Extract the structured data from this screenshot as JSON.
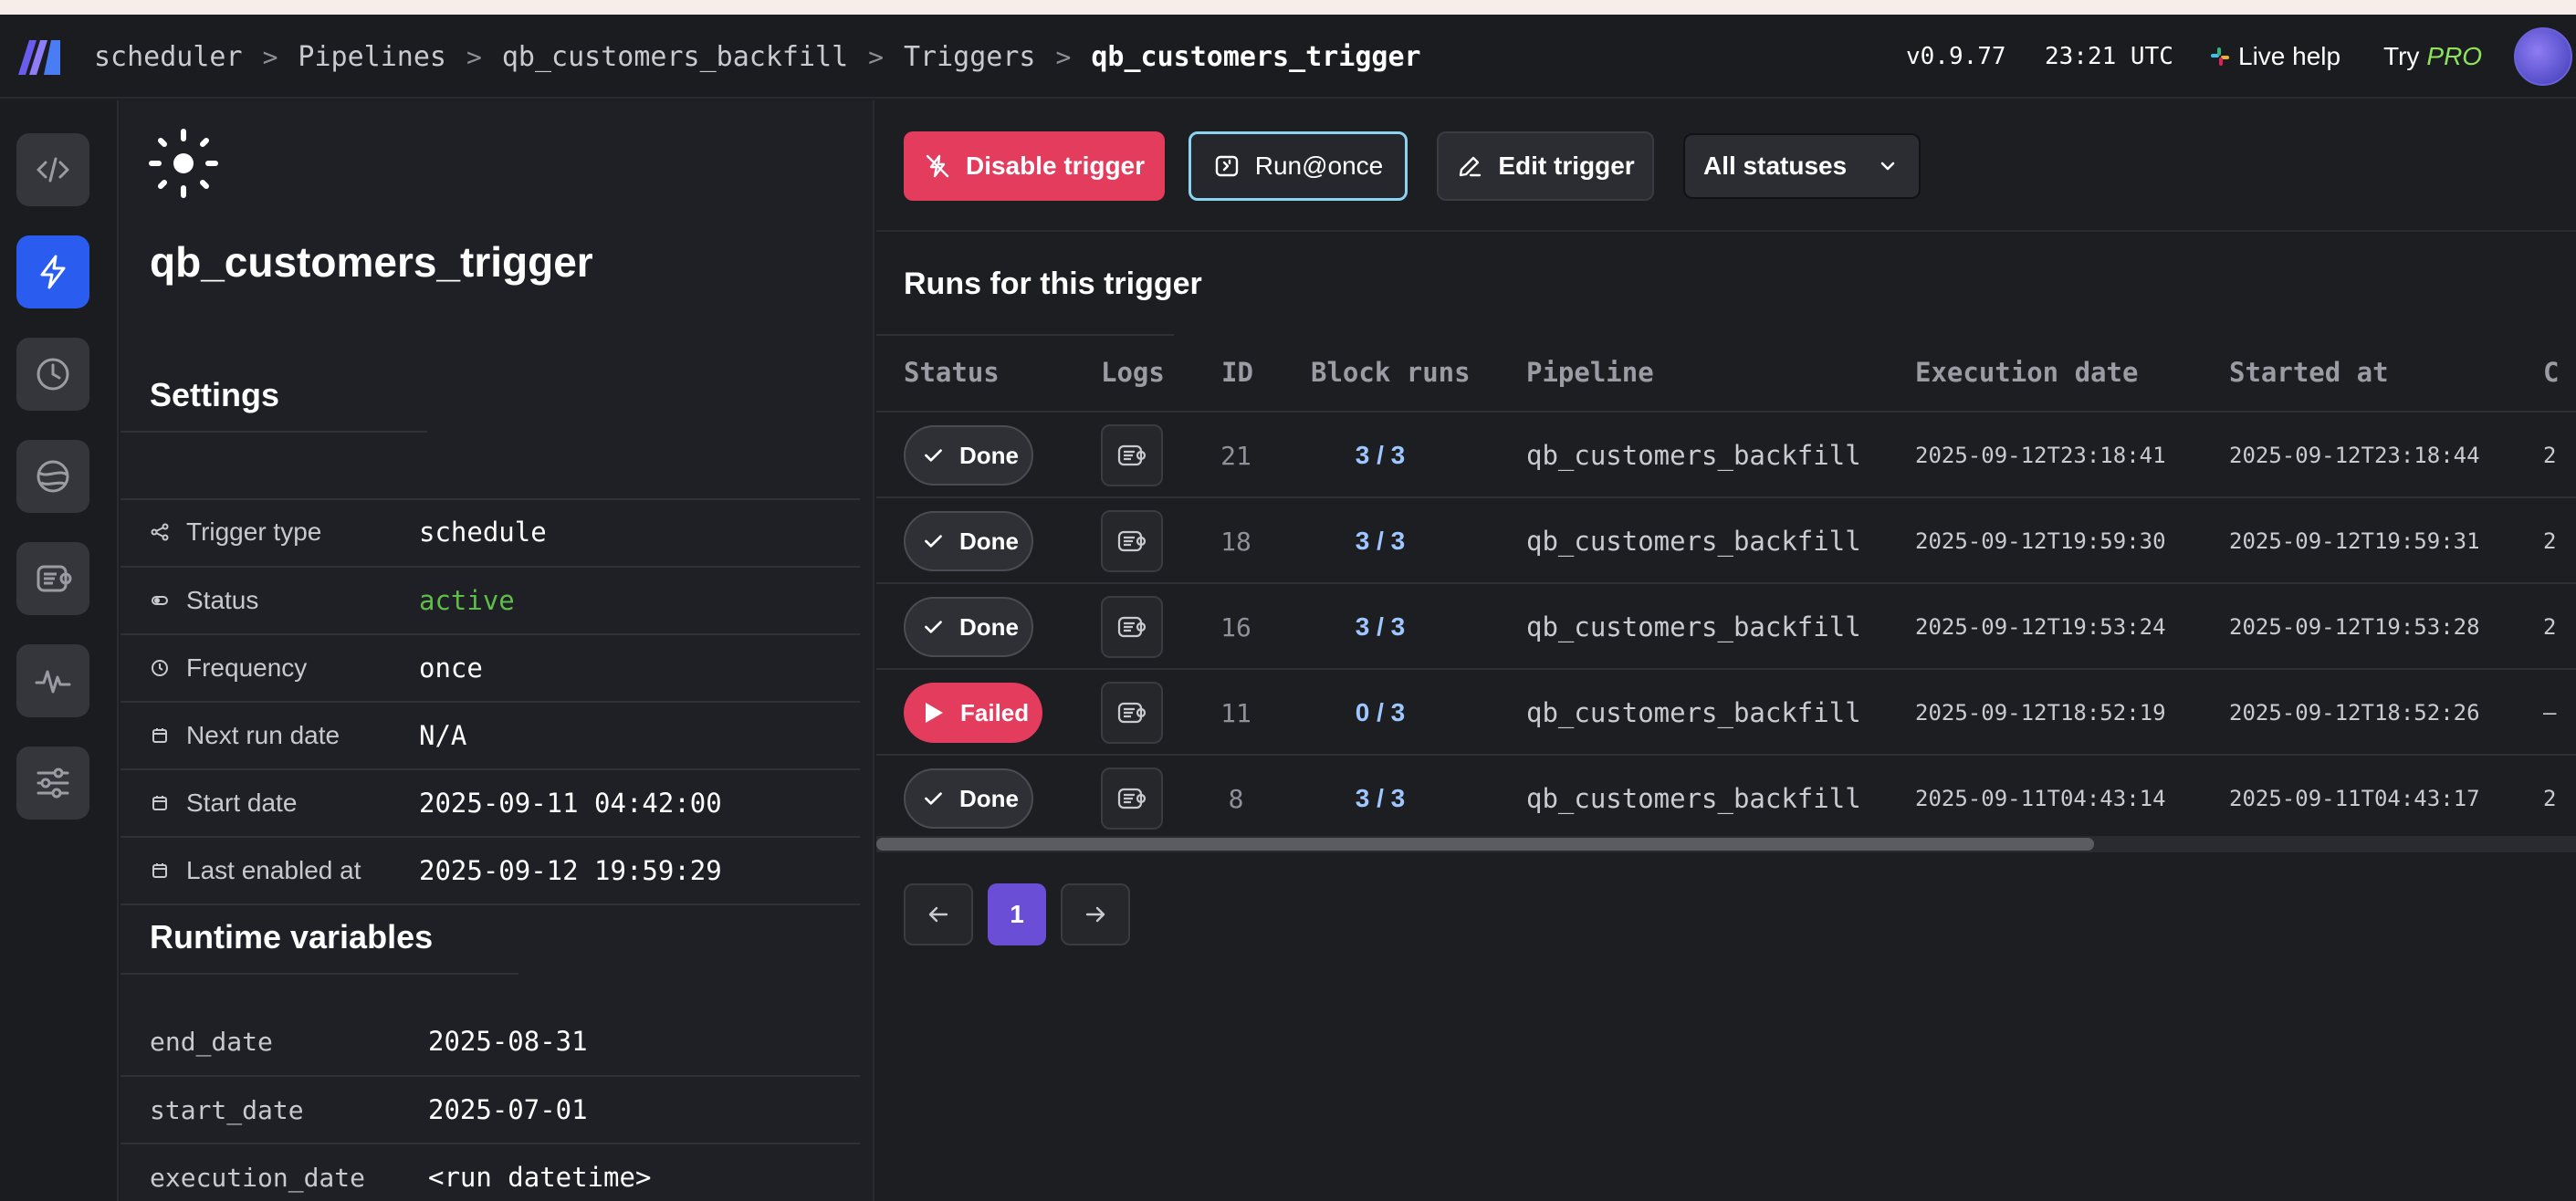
{
  "header": {
    "breadcrumb": [
      "scheduler",
      "Pipelines",
      "qb_customers_backfill",
      "Triggers"
    ],
    "current": "qb_customers_trigger",
    "separator": ">",
    "version": "v0.9.77",
    "time": "23:21 UTC",
    "live_help": "Live help",
    "try_label": "Try",
    "pro_label": "PRO"
  },
  "nav": {
    "items": [
      "code-icon",
      "lightning-icon",
      "clock-icon",
      "globe-icon",
      "logs-icon",
      "pulse-icon",
      "sliders-icon"
    ],
    "active": "lightning-icon"
  },
  "trigger": {
    "name": "qb_customers_trigger",
    "settings_title": "Settings",
    "settings": [
      {
        "key": "Trigger type",
        "value": "schedule"
      },
      {
        "key": "Status",
        "value": "active"
      },
      {
        "key": "Frequency",
        "value": "once"
      },
      {
        "key": "Next run date",
        "value": "N/A"
      },
      {
        "key": "Start date",
        "value": "2025-09-11 04:42:00"
      },
      {
        "key": "Last enabled at",
        "value": "2025-09-12 19:59:29"
      }
    ],
    "runtime_title": "Runtime variables",
    "runtime_variables": [
      {
        "key": "end_date",
        "value": "2025-08-31"
      },
      {
        "key": "start_date",
        "value": "2025-07-01"
      },
      {
        "key": "execution_date",
        "value": "<run datetime>"
      }
    ]
  },
  "toolbar": {
    "disable_label": "Disable trigger",
    "run_once_label": "Run@once",
    "edit_label": "Edit trigger",
    "status_filter": "All statuses"
  },
  "runs": {
    "title": "Runs for this trigger",
    "columns": [
      "Status",
      "Logs",
      "ID",
      "Block runs",
      "Pipeline",
      "Execution date",
      "Started at",
      "C"
    ],
    "rows": [
      {
        "status": "Done",
        "id": "21",
        "block_runs": "3 / 3",
        "pipeline": "qb_customers_backfill",
        "execution_date": "2025-09-12T23:18:41",
        "started_at": "2025-09-12T23:18:44",
        "completed": "2"
      },
      {
        "status": "Done",
        "id": "18",
        "block_runs": "3 / 3",
        "pipeline": "qb_customers_backfill",
        "execution_date": "2025-09-12T19:59:30",
        "started_at": "2025-09-12T19:59:31",
        "completed": "2"
      },
      {
        "status": "Done",
        "id": "16",
        "block_runs": "3 / 3",
        "pipeline": "qb_customers_backfill",
        "execution_date": "2025-09-12T19:53:24",
        "started_at": "2025-09-12T19:53:28",
        "completed": "2"
      },
      {
        "status": "Failed",
        "id": "11",
        "block_runs": "0 / 3",
        "pipeline": "qb_customers_backfill",
        "execution_date": "2025-09-12T18:52:19",
        "started_at": "2025-09-12T18:52:26",
        "completed": "–"
      },
      {
        "status": "Done",
        "id": "8",
        "block_runs": "3 / 3",
        "pipeline": "qb_customers_backfill",
        "execution_date": "2025-09-11T04:43:14",
        "started_at": "2025-09-11T04:43:17",
        "completed": "2"
      }
    ]
  },
  "pagination": {
    "current_page": "1"
  },
  "colors": {
    "accent": "#2b5cf0",
    "danger": "#e33c5c",
    "success": "#5fbd4a",
    "page_active": "#6a4fd6",
    "run_once_border": "#8bd3f0"
  }
}
